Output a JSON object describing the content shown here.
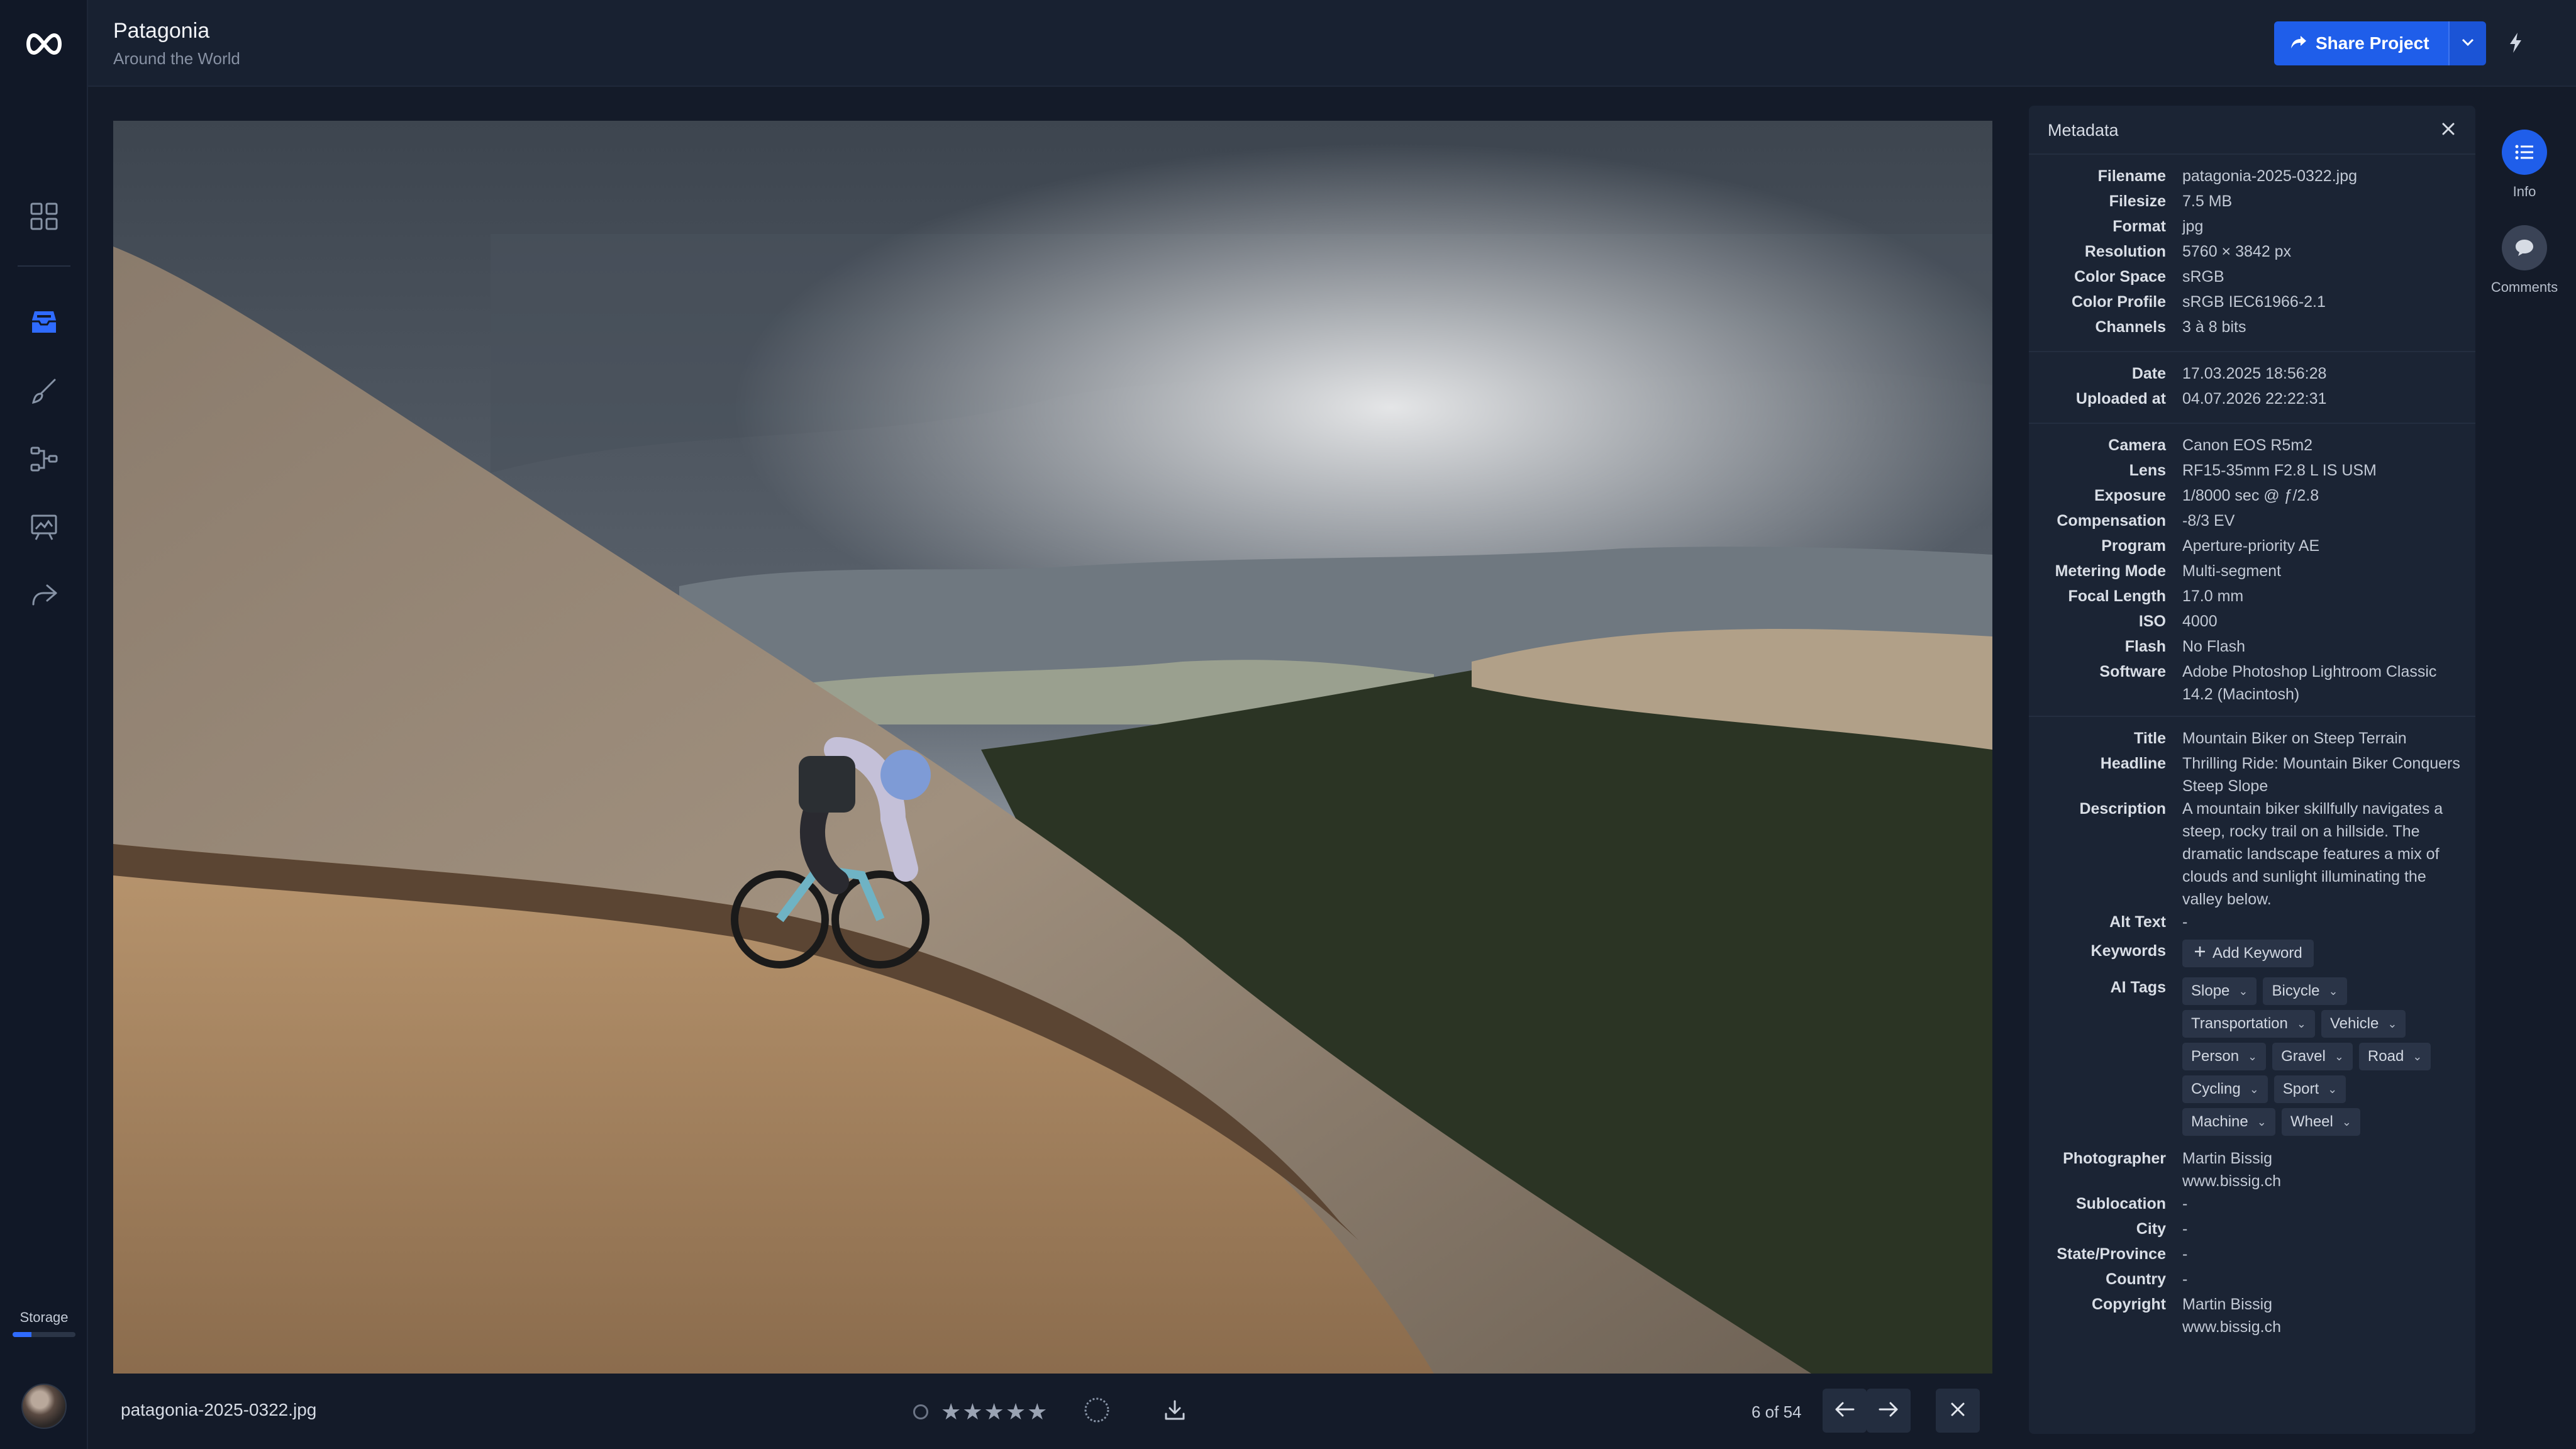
{
  "app": {
    "logo_icon": "infinity-logo-icon",
    "storage_label": "Storage",
    "storage_used_fraction": 0.3,
    "accent_color": "#1f5eea"
  },
  "nav": [
    {
      "icon": "grid-icon",
      "active": false
    },
    {
      "icon": "inbox-tray-icon",
      "active": true
    },
    {
      "icon": "brush-icon",
      "active": false
    },
    {
      "icon": "workflow-icon",
      "active": false
    },
    {
      "icon": "presentation-icon",
      "active": false
    },
    {
      "icon": "share-arrow-icon",
      "active": false
    }
  ],
  "header": {
    "title": "Patagonia",
    "subtitle": "Around the World",
    "share_label": "Share Project"
  },
  "viewer": {
    "filename": "patagonia-2025-0322.jpg",
    "stars": "★★★★★",
    "rating": 0,
    "counter": "6 of 54"
  },
  "metadata": {
    "title": "Metadata",
    "file": [
      {
        "label": "Filename",
        "value": "patagonia-2025-0322.jpg"
      },
      {
        "label": "Filesize",
        "value": "7.5 MB"
      },
      {
        "label": "Format",
        "value": "jpg"
      },
      {
        "label": "Resolution",
        "value": "5760 × 3842 px"
      },
      {
        "label": "Color Space",
        "value": "sRGB"
      },
      {
        "label": "Color Profile",
        "value": "sRGB IEC61966-2.1"
      },
      {
        "label": "Channels",
        "value": "3 à 8 bits"
      }
    ],
    "dates": [
      {
        "label": "Date",
        "value": "17.03.2025 18:56:28"
      },
      {
        "label": "Uploaded at",
        "value": "04.07.2026 22:22:31"
      }
    ],
    "camera": [
      {
        "label": "Camera",
        "value": "Canon EOS R5m2"
      },
      {
        "label": "Lens",
        "value": "RF15-35mm F2.8 L IS USM"
      },
      {
        "label": "Exposure",
        "value": "1/8000 sec @ ƒ/2.8"
      },
      {
        "label": "Compensation",
        "value": "-8/3 EV"
      },
      {
        "label": "Program",
        "value": "Aperture-priority AE"
      },
      {
        "label": "Metering Mode",
        "value": "Multi-segment"
      },
      {
        "label": "Focal Length",
        "value": "17.0 mm"
      },
      {
        "label": "ISO",
        "value": "4000"
      },
      {
        "label": "Flash",
        "value": "No Flash"
      },
      {
        "label": "Software",
        "value": "Adobe Photoshop Lightroom Classic 14.2 (Macintosh)"
      }
    ],
    "iptc_top": [
      {
        "label": "Title",
        "value": "Mountain Biker on Steep Terrain"
      },
      {
        "label": "Headline",
        "value": "Thrilling Ride: Mountain Biker Conquers Steep Slope"
      },
      {
        "label": "Description",
        "value": "A mountain biker skillfully navigates a steep, rocky trail on a hillside. The dramatic landscape features a mix of clouds and sunlight illuminating the valley below."
      },
      {
        "label": "Alt Text",
        "value": "-"
      }
    ],
    "keywords_label": "Keywords",
    "add_keyword_label": "Add Keyword",
    "ai_tags_label": "AI Tags",
    "ai_tags": [
      "Slope",
      "Bicycle",
      "Transportation",
      "Vehicle",
      "Person",
      "Gravel",
      "Road",
      "Cycling",
      "Sport",
      "Machine",
      "Wheel"
    ],
    "iptc_bottom": [
      {
        "label": "Photographer",
        "value": "Martin Bissig\nwww.bissig.ch"
      },
      {
        "label": "Sublocation",
        "value": "-"
      },
      {
        "label": "City",
        "value": "-"
      },
      {
        "label": "State/Province",
        "value": "-"
      },
      {
        "label": "Country",
        "value": "-"
      },
      {
        "label": "Copyright",
        "value": "Martin Bissig\nwww.bissig.ch"
      }
    ]
  },
  "side_tabs": [
    {
      "label": "Info",
      "icon": "list-icon",
      "active": true
    },
    {
      "label": "Comments",
      "icon": "comment-bubble-icon",
      "active": false
    }
  ]
}
